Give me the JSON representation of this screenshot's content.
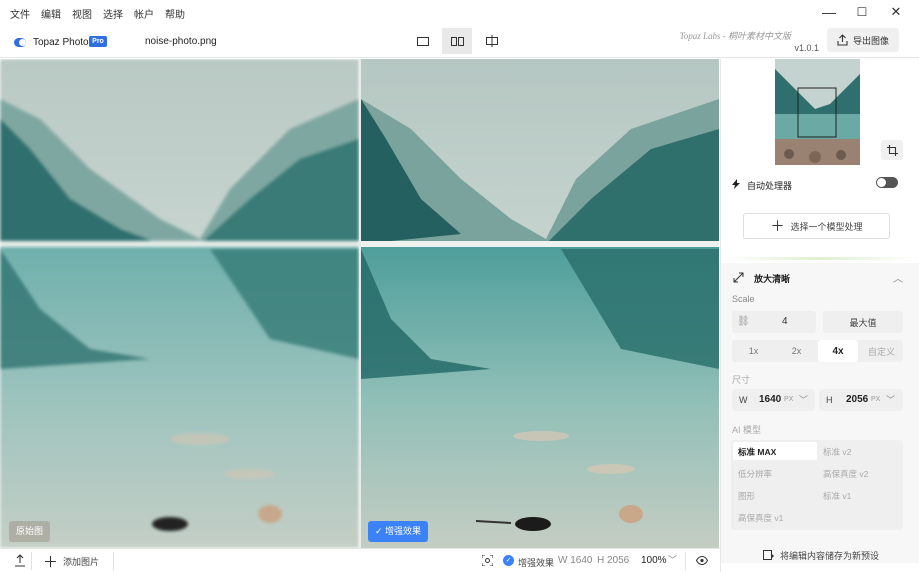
{
  "menubar": {
    "items": [
      "文件",
      "编辑",
      "视图",
      "选择",
      "帐户",
      "帮助"
    ],
    "minimize": "—",
    "maximize": "☐",
    "close": "✕"
  },
  "toolbar": {
    "brand": "Topaz Photo",
    "badge": "Pro",
    "filename": "noise-photo.png",
    "title": "Topaz Labs - 桐叶素材中文版",
    "version": "v1.0.1",
    "export_label": "导出图像"
  },
  "canvas": {
    "left_tag": "原始图",
    "right_tag": "增强效果"
  },
  "sidebar": {
    "auto_label": "自动处理器",
    "auto_on": false,
    "select_model": "选择一个模型处理",
    "upscale": {
      "title": "放大清晰",
      "scale_label": "Scale",
      "scale_value": "4",
      "max_label": "最大值",
      "options": [
        "1x",
        "2x",
        "4x",
        "自定义"
      ],
      "selected": "4x",
      "size_label": "尺寸",
      "w_prefix": "W",
      "w_value": "1640",
      "h_prefix": "H",
      "h_value": "2056",
      "unit": "PX",
      "ai_label": "AI 模型",
      "models": [
        "标准 MAX",
        "标准 v2",
        "低分辨率",
        "高保真度 v2",
        "图形",
        "标准 v1",
        "高保真度 v1"
      ],
      "selected_model": "标准 MAX"
    },
    "save_preset": "将编辑内容储存为新预设"
  },
  "statusbar": {
    "add_image": "添加图片",
    "enhance_label": "增强效果",
    "w_info": "W 1640",
    "h_info": "H 2056",
    "zoom": "100%"
  },
  "colors": {
    "accent": "#2f6fe0",
    "tag_blue": "#3b82f6"
  }
}
